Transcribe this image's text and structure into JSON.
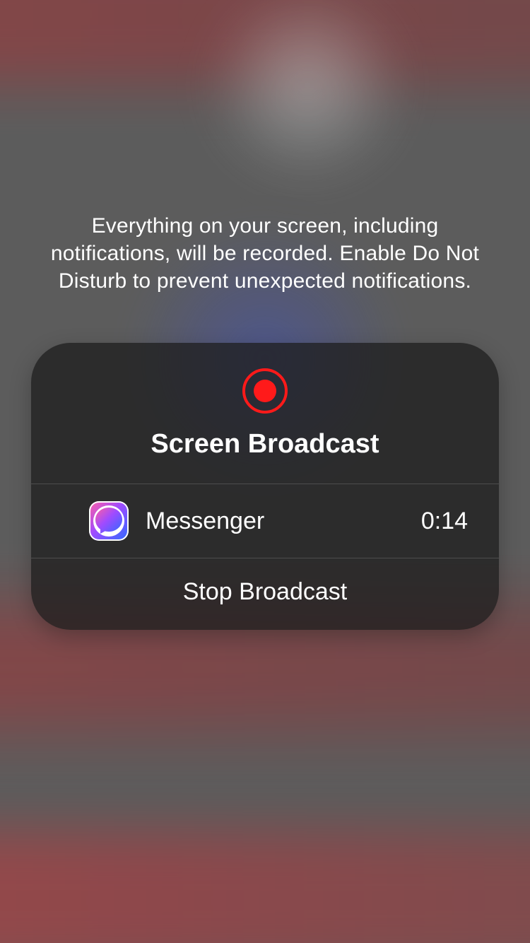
{
  "warning_text": "Everything on your screen, including notifications, will be recorded. Enable Do Not Disturb to prevent unexpected notifications.",
  "card": {
    "title": "Screen Broadcast",
    "app_name": "Messenger",
    "elapsed": "0:14",
    "stop_label": "Stop Broadcast"
  }
}
